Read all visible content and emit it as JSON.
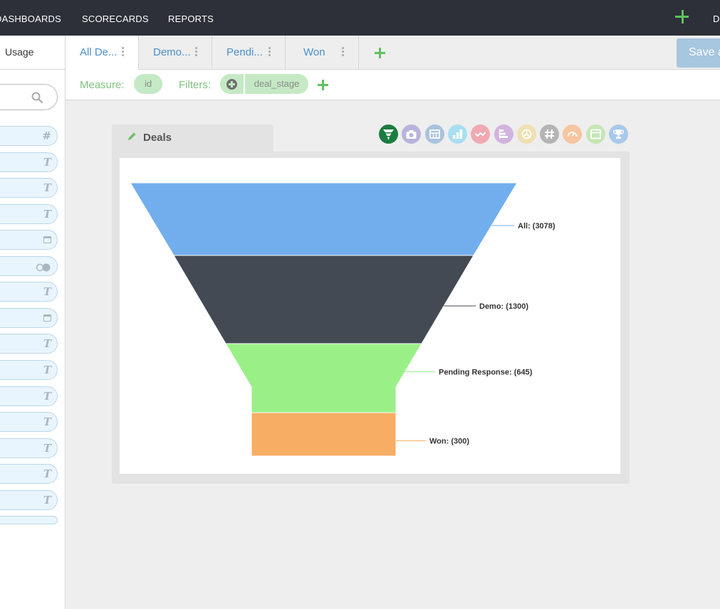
{
  "topbar": {
    "nav": [
      "DASHBOARDS",
      "SCORECARDS",
      "REPORTS"
    ],
    "right_cut_text": "D"
  },
  "left_panel": {
    "tab_label": "Usage",
    "field_icons": [
      "hash",
      "text",
      "text",
      "text",
      "calendar",
      "toggle",
      "text",
      "calendar",
      "text",
      "text",
      "text",
      "text",
      "text",
      "text",
      "text"
    ]
  },
  "tabs": [
    {
      "label": "All De...",
      "active": true
    },
    {
      "label": "Demo...",
      "active": false
    },
    {
      "label": "Pendi...",
      "active": false
    },
    {
      "label": "Won",
      "active": false
    }
  ],
  "save_button": "Save a",
  "filters": {
    "measure_label": "Measure:",
    "measure_value": "id",
    "filters_label": "Filters:",
    "filter_value": "deal_stage"
  },
  "widget": {
    "title": "Deals",
    "chart_types": [
      {
        "name": "funnel",
        "color": "#1a7d3f"
      },
      {
        "name": "camera",
        "color": "#b8b3dc"
      },
      {
        "name": "table",
        "color": "#a9c2de"
      },
      {
        "name": "bar",
        "color": "#a8dff0"
      },
      {
        "name": "line",
        "color": "#f0a9b2"
      },
      {
        "name": "horizontal-bar",
        "color": "#d1b3de"
      },
      {
        "name": "pie",
        "color": "#f0e0b1"
      },
      {
        "name": "number",
        "color": "#b4b4b4"
      },
      {
        "name": "gauge",
        "color": "#f7c59f"
      },
      {
        "name": "list",
        "color": "#c5e6b5"
      },
      {
        "name": "trophy",
        "color": "#a9c8ec"
      }
    ]
  },
  "chart_data": {
    "type": "funnel",
    "categories": [
      "All",
      "Demo",
      "Pending Response",
      "Won"
    ],
    "values": [
      3078,
      1300,
      645,
      300
    ],
    "labels": [
      "All: (3078)",
      "Demo: (1300)",
      "Pending Response: (645)",
      "Won: (300)"
    ],
    "colors": [
      "#72aeee",
      "#434a54",
      "#9af087",
      "#f7ae64"
    ]
  }
}
